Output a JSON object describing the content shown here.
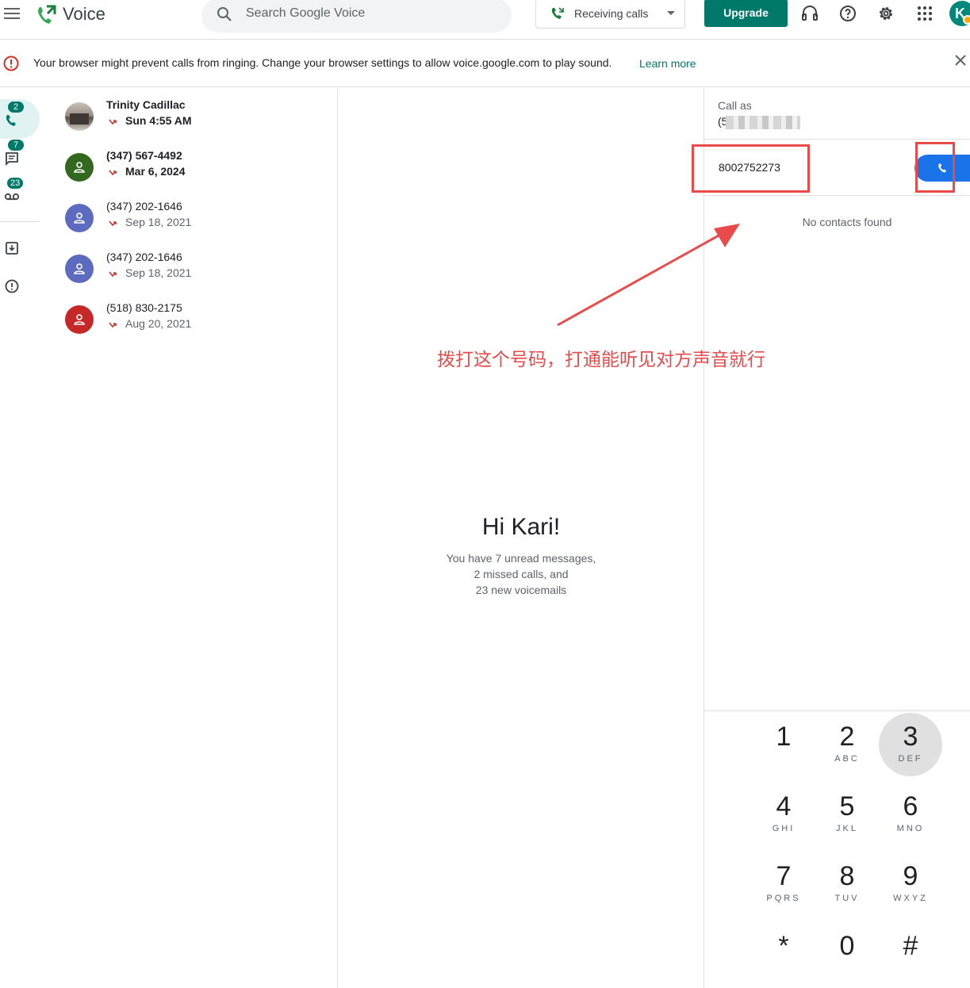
{
  "app": {
    "title": "Voice"
  },
  "search": {
    "placeholder": "Search Google Voice"
  },
  "header": {
    "receiving_label": "Receiving calls",
    "upgrade_label": "Upgrade",
    "avatar_initial": "K",
    "icons": [
      "menu-icon",
      "voice-logo-icon",
      "search-icon",
      "phone-forward-icon",
      "headset-icon",
      "help-icon",
      "settings-icon",
      "apps-grid-icon"
    ]
  },
  "banner": {
    "text": "Your browser might prevent calls from ringing. Change your browser settings to allow voice.google.com to play sound.",
    "link": "Learn more"
  },
  "rail": {
    "calls_badge": "2",
    "messages_badge": "7",
    "voicemail_badge": "23"
  },
  "calls": [
    {
      "name": "Trinity Cadillac",
      "time": "Sun 4:55 AM",
      "unread": true,
      "avatar_color": "photo"
    },
    {
      "name": "(347) 567-4492",
      "time": "Mar 6, 2024",
      "unread": true,
      "avatar_color": "#33691e"
    },
    {
      "name": "(347) 202-1646",
      "time": "Sep 18, 2021",
      "unread": false,
      "avatar_color": "#5c6bc0"
    },
    {
      "name": "(347) 202-1646",
      "time": "Sep 18, 2021",
      "unread": false,
      "avatar_color": "#5c6bc0"
    },
    {
      "name": "(518) 830-2175",
      "time": "Aug 20, 2021",
      "unread": false,
      "avatar_color": "#c62828"
    }
  ],
  "welcome": {
    "title": "Hi Kari!",
    "line1": "You have 7 unread messages,",
    "line2": "2 missed calls, and",
    "line3": "23 new voicemails"
  },
  "dialer": {
    "call_as_label": "Call as",
    "call_as_number": "(5",
    "input_value": "8002752273",
    "no_contacts": "No contacts found",
    "keys": [
      {
        "digit": "1",
        "letters": ""
      },
      {
        "digit": "2",
        "letters": "ABC"
      },
      {
        "digit": "3",
        "letters": "DEF"
      },
      {
        "digit": "4",
        "letters": "GHI"
      },
      {
        "digit": "5",
        "letters": "JKL"
      },
      {
        "digit": "6",
        "letters": "MNO"
      },
      {
        "digit": "7",
        "letters": "PQRS"
      },
      {
        "digit": "8",
        "letters": "TUV"
      },
      {
        "digit": "9",
        "letters": "WXYZ"
      },
      {
        "digit": "*",
        "letters": ""
      },
      {
        "digit": "0",
        "letters": ""
      },
      {
        "digit": "#",
        "letters": ""
      }
    ]
  },
  "annotation": {
    "text": "拨打这个号码，打通能听见对方声音就行",
    "color": "#e94b4b"
  },
  "colors": {
    "accent": "#00796b",
    "call_button": "#1a73e8",
    "missed": "#d93025"
  }
}
